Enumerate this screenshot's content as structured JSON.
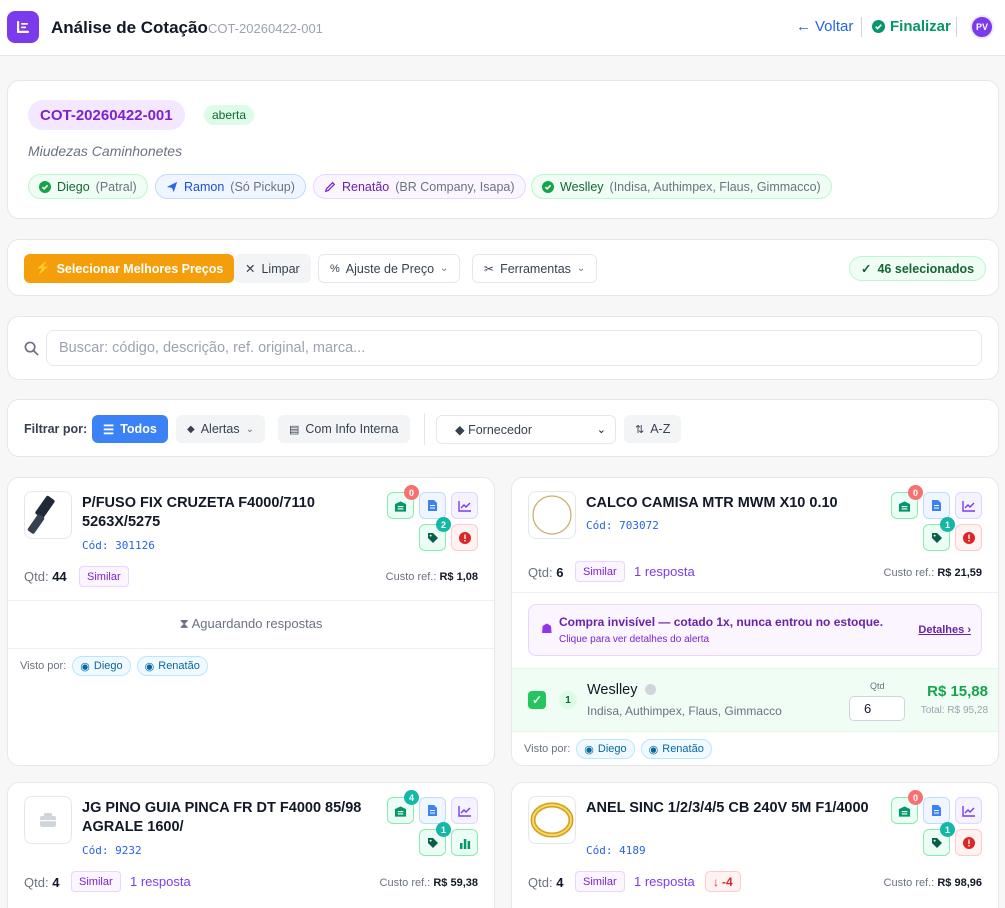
{
  "header": {
    "title": "Análise de Cotação",
    "code": "COT-20260422-001",
    "voltar": "Voltar",
    "finalizar": "Finalizar",
    "avatar": "PV",
    "accent": "#7c3aed"
  },
  "quote": {
    "code": "COT-20260422-001",
    "status": "aberta",
    "description": "Miudezas Caminhonetes",
    "suppliers": [
      {
        "name": "Diego",
        "sub": "(Patral)",
        "icon": "check-circle-icon",
        "color": "#16a34a"
      },
      {
        "name": "Ramon",
        "sub": "(Só Pickup)",
        "icon": "send-icon",
        "color": "#2563eb"
      },
      {
        "name": "Renatão",
        "sub": "(BR Company, Isapa)",
        "icon": "edit-icon",
        "color": "#7e22ce"
      },
      {
        "name": "Weslley",
        "sub": "(Indisa, Authimpex, Flaus, Gimmacco)",
        "icon": "check-circle-icon",
        "color": "#16a34a"
      }
    ]
  },
  "toolbar": {
    "best_prices": "Selecionar Melhores Preços",
    "clear": "Limpar",
    "price_adjust": "Ajuste de Preço",
    "tools": "Ferramentas",
    "selected_count": "46 selecionados"
  },
  "search": {
    "placeholder": "Buscar: código, descrição, ref. original, marca..."
  },
  "filters": {
    "label": "Filtrar por:",
    "all": "Todos",
    "alerts": "Alertas",
    "internal_info": "Com Info Interna",
    "supplier_select": "◆ Fornecedor",
    "sort": "A-Z"
  },
  "items": [
    {
      "title": "P/FUSO FIX CRUZETA F4000/7110 5263X/5275",
      "code": "Cód: 301126",
      "qty_label": "Qtd:",
      "qty": "44",
      "tag": "Similar",
      "cost_label": "Custo ref.:",
      "cost": "R$ 1,08",
      "badge_stock": "0",
      "badge_tag": "2",
      "waiting": "Aguardando respostas",
      "seen_label": "Visto por:",
      "seen": [
        "Diego",
        "Renatão"
      ]
    },
    {
      "title": "CALCO CAMISA MTR MWM X10 0.10",
      "code": "Cód: 703072",
      "qty_label": "Qtd:",
      "qty": "6",
      "tag": "Similar",
      "responses": "1 resposta",
      "cost_label": "Custo ref.:",
      "cost": "R$ 21,59",
      "badge_stock": "0",
      "badge_tag": "1",
      "alert_title": "Compra invisível — cotado 1x, nunca entrou no estoque.",
      "alert_sub": "Clique para ver detalhes do alerta",
      "alert_link": "Detalhes",
      "offer": {
        "rank": "1",
        "supplier": "Weslley",
        "brands": "Indisa, Authimpex, Flaus, Gimmacco",
        "qty_label": "Qtd",
        "qty": "6",
        "price": "R$ 15,88",
        "total": "Total: R$ 95,28"
      },
      "seen_label": "Visto por:",
      "seen": [
        "Diego",
        "Renatão"
      ]
    },
    {
      "title": "JG PINO GUIA PINCA FR DT F4000 85/98 AGRALE 1600/",
      "code": "Cód: 9232",
      "qty_label": "Qtd:",
      "qty": "4",
      "tag": "Similar",
      "responses": "1 resposta",
      "cost_label": "Custo ref.:",
      "cost": "R$ 59,38",
      "badge_stock": "4",
      "badge_tag": "1"
    },
    {
      "title": "ANEL SINC 1/2/3/4/5 CB 240V 5M F1/4000",
      "code": "Cód: 4189",
      "qty_label": "Qtd:",
      "qty": "4",
      "tag": "Similar",
      "responses": "1 resposta",
      "trend": "-4",
      "cost_label": "Custo ref.:",
      "cost": "R$ 98,96",
      "badge_stock": "0",
      "badge_tag": "1"
    }
  ]
}
